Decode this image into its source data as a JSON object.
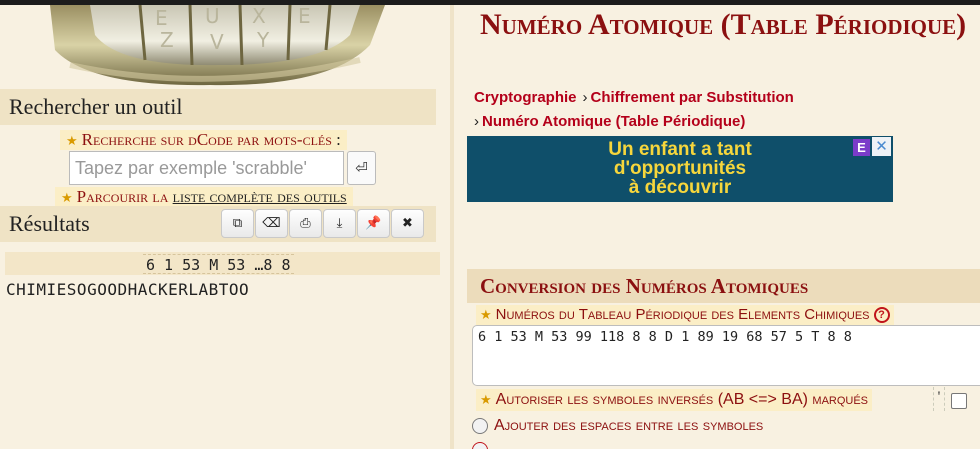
{
  "left": {
    "search_panel_title": "Rechercher un outil",
    "keyword_search_label": "Recherche sur dCode par mots-clés",
    "keyword_search_colon": ":",
    "search_placeholder": "Tapez par exemple 'scrabble'",
    "enter_glyph": "⏎",
    "browse_prefix": "Parcourir la",
    "browse_link": "liste complète des outils",
    "results_title": "Résultats",
    "tool_icons": [
      "copy-icon",
      "eraser-icon",
      "print-icon",
      "download-icon",
      "pin-icon",
      "close-icon"
    ],
    "tool_glyphs": [
      "⧉",
      "⌫",
      "⎙",
      "⤓",
      "📌",
      "✖"
    ],
    "result_numbers": "6 1 53 M 53 …8 8",
    "result_text": "CHIMIESOGOODHACKERLABTOO"
  },
  "right": {
    "page_title": "Numéro Atomique (Table Périodique)",
    "breadcrumb": [
      {
        "label": "Cryptographie",
        "sep": "›"
      },
      {
        "label": "Chiffrement par Substitution",
        "sep": "›"
      },
      {
        "label": "Numéro Atomique (Table Périodique)",
        "sep": "›"
      }
    ],
    "ad": {
      "line1": "Un enfant a tant",
      "line2": "d'opportunités",
      "line3": "à découvrir",
      "badge": "E",
      "close": "✕"
    },
    "section_title": "Conversion des Numéros Atomiques",
    "input_label": "Numéros du Tableau Périodique des Elements Chimiques",
    "help_glyph": "?",
    "input_value": "6 1 53 M 53 99 118 8 8 D 1 89 19 68 57 5 T 8 8",
    "option_inverse_label": "Autoriser les symboles inversés (AB <=> BA) marqués",
    "option_inverse_quote": "'",
    "option_inverse_checked": false,
    "radio_spaces_label": "Ajouter des espaces entre les symboles"
  },
  "colors": {
    "background": "#f8f1e1",
    "title_red": "#8b1010",
    "link_red": "#b4001a",
    "panel_tan": "#efe3c5",
    "ad_blue": "#0f4f6a",
    "ad_yellow": "#f6d63c"
  }
}
